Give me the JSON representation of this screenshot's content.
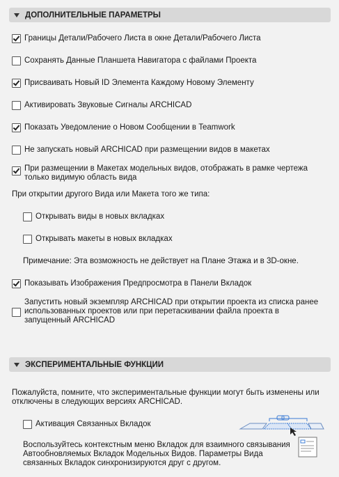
{
  "sections": {
    "advanced_title": "ДОПОЛНИТЕЛЬНЫЕ ПАРАМЕТРЫ",
    "experimental_title": "ЭКСПЕРИМЕНТАЛЬНЫЕ ФУНКЦИИ"
  },
  "options": {
    "o1": {
      "label": "Границы Детали/Рабочего Листа в окне Детали/Рабочего Листа",
      "checked": true
    },
    "o2": {
      "label": "Сохранять Данные Планшета Навигатора с файлами Проекта",
      "checked": false
    },
    "o3": {
      "label": "Присваивать Новый ID Элемента Каждому Новому Элементу",
      "checked": true
    },
    "o4": {
      "label": "Активировать Звуковые Сигналы ARCHICAD",
      "checked": false
    },
    "o5": {
      "label": "Показать Уведомление о Новом Сообщении в Teamwork",
      "checked": true
    },
    "o6": {
      "label": "Не запускать новый  ARCHICAD при размещении видов в макетах",
      "checked": false
    },
    "o7": {
      "label": "При размещении в Макетах модельных видов, отображать в рамке чертежа только видимую область вида",
      "checked": true
    },
    "o8": {
      "label": "Открывать виды в новых вкладках",
      "checked": false
    },
    "o9": {
      "label": "Открывать макеты в новых вкладках",
      "checked": false
    },
    "o10": {
      "label": "Показывать Изображения Предпросмотра в Панели Вкладок",
      "checked": true
    },
    "o11": {
      "label": "Запустить новый экземпляр ARCHICAD при открытии проекта из списка ранее использованных проектов или при перетаскивании файла проекта в запущенный ARCHICAD",
      "checked": false
    },
    "o12": {
      "label": "Активация Связанных Вкладок",
      "checked": false
    }
  },
  "texts": {
    "open_other_heading": "При открытии другого Вида или Макета того же типа:",
    "note": "Примечание: Эта возможность не действует на Плане Этажа и в 3D-окне.",
    "experimental_warning": "Пожалуйста, помните, что экспериментальные функции могут быть изменены или отключены в следующих версиях ARCHICAD.",
    "linked_tabs_help": "Воспользуйтесь контекстным меню Вкладок для взаимного связывания Автообновляемых Вкладок Модельных Видов. Параметры Вида связанных Вкладок синхронизируются друг с другом."
  },
  "icons": {
    "illustration": "linked-tabs-illustration",
    "accent": "#3b7bd4"
  }
}
